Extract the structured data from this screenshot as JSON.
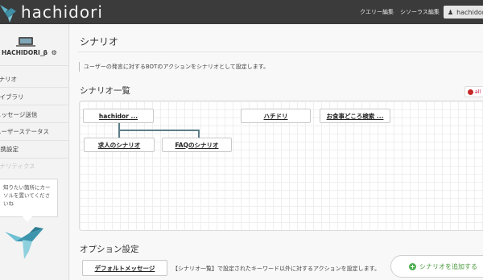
{
  "brand": {
    "name": "hachidori"
  },
  "header": {
    "nav": [
      {
        "label": "クエリー編集"
      },
      {
        "label": "シソーラス編集"
      }
    ],
    "user": {
      "label": "hachidori"
    }
  },
  "sidebar": {
    "account_name": "HACHIDORI_β",
    "items": [
      {
        "label": "シナリオ",
        "enabled": true
      },
      {
        "label": "ライブラリ",
        "enabled": true
      },
      {
        "label": "メッセージ送信",
        "enabled": true
      },
      {
        "label": "ユーザーステータス",
        "enabled": true
      },
      {
        "label": "連携設定",
        "enabled": true
      },
      {
        "label": "アナリティクス",
        "enabled": false
      }
    ],
    "tip_text": "知りたい箇所にカーソルを置いてくださいね"
  },
  "main": {
    "title": "シナリオ",
    "description": "ユーザーの発言に対するBOTのアクションをシナリオとして設定します。",
    "scenario_list": {
      "title": "シナリオ一覧",
      "badge": "all",
      "nodes": [
        {
          "label": "hachidor ..."
        },
        {
          "label": "求人のシナリオ"
        },
        {
          "label": "FAQのシナリオ"
        },
        {
          "label": "ハチドリ"
        },
        {
          "label": "お食事どころ検索 ..."
        }
      ]
    },
    "options": {
      "title": "オプション設定",
      "default_message_label": "デフォルトメッセージ",
      "default_message_desc": "【シナリオ一覧】で設定されたキーワード以外に対するアクションを設定します。"
    },
    "add_button_label": "シナリオを追加する"
  },
  "colors": {
    "topbar": "#3b3b3b",
    "connector": "#5d7d88",
    "add_accent": "#4caf50"
  }
}
